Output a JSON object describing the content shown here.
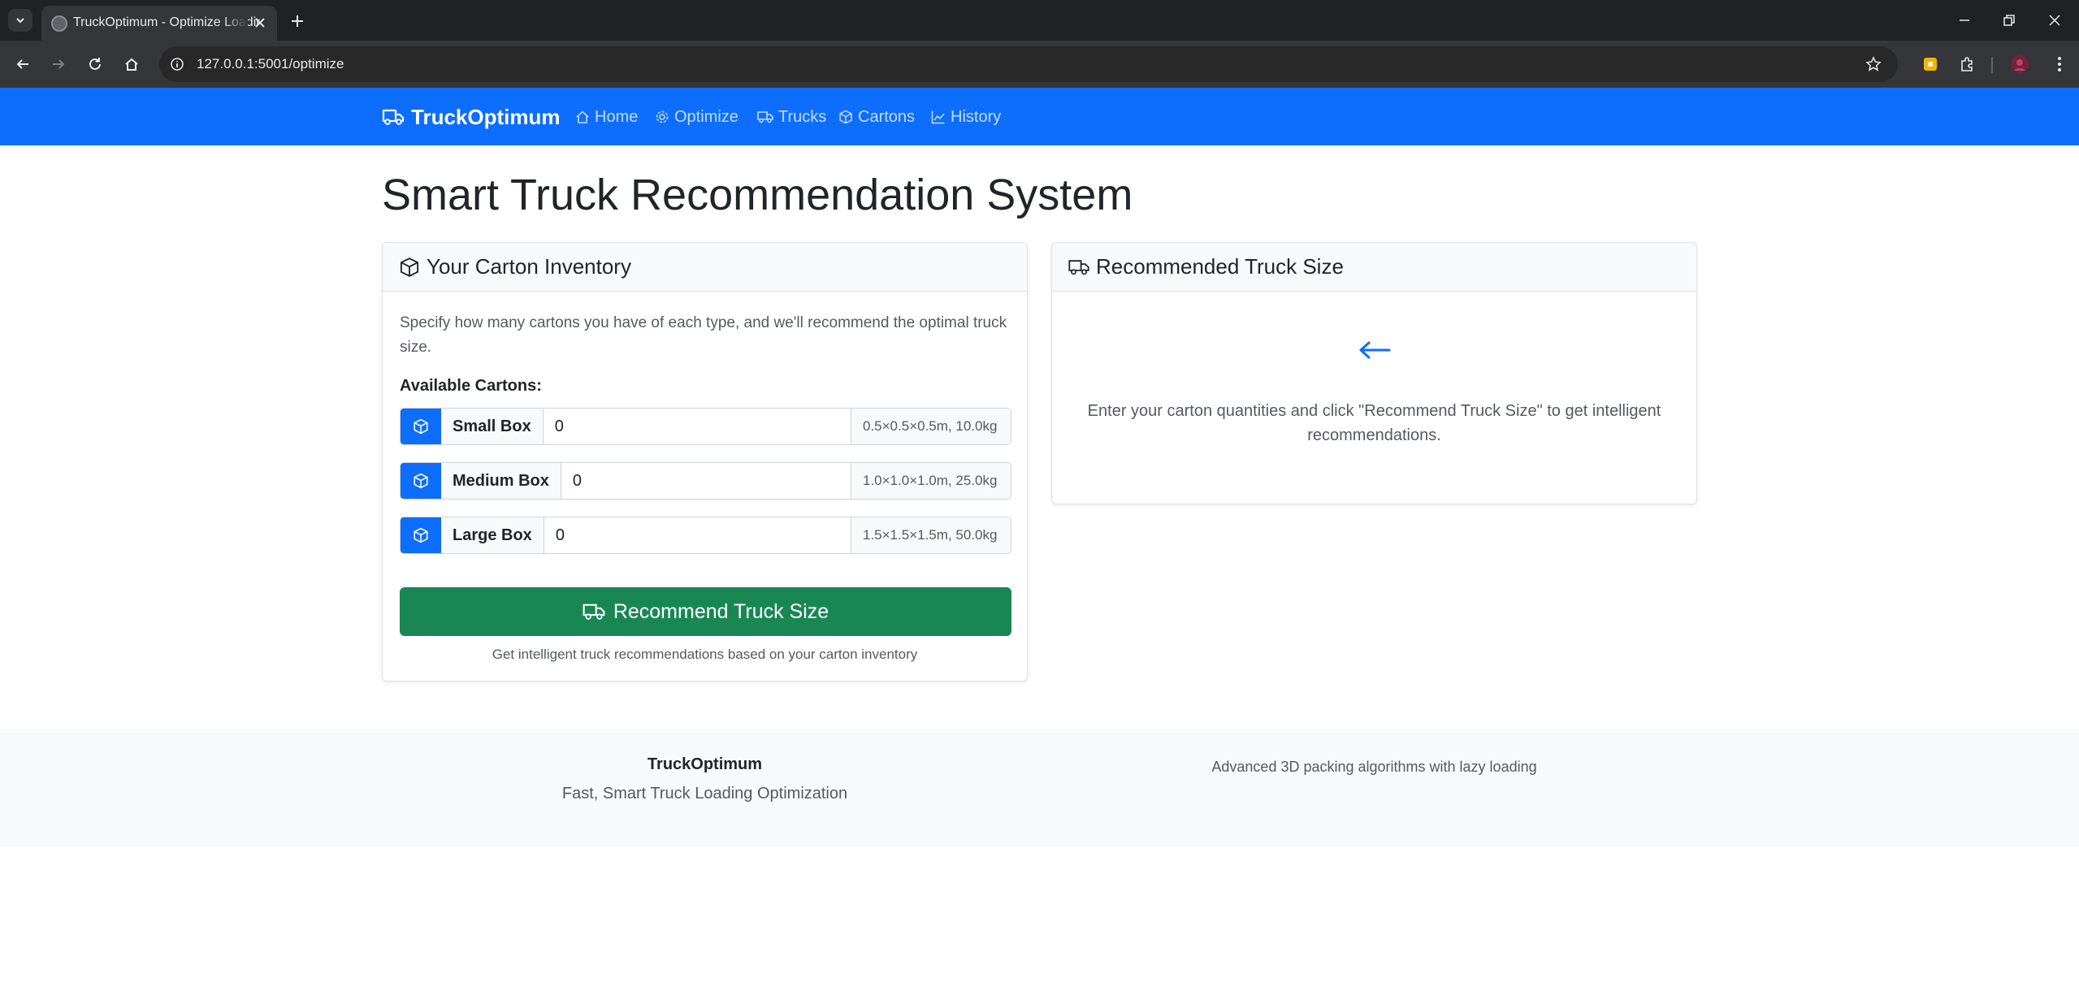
{
  "browser": {
    "tab_title": "TruckOptimum - Optimize Loading",
    "url": "127.0.0.1:5001/optimize"
  },
  "navbar": {
    "brand": "TruckOptimum",
    "links": [
      {
        "label": "Home",
        "icon": "house-icon"
      },
      {
        "label": "Optimize",
        "icon": "gear-icon"
      },
      {
        "label": "Trucks",
        "icon": "truck-icon"
      },
      {
        "label": "Cartons",
        "icon": "box-icon"
      },
      {
        "label": "History",
        "icon": "chart-line-icon"
      }
    ]
  },
  "page": {
    "title": "Smart Truck Recommendation System"
  },
  "inventory": {
    "header": "Your Carton Inventory",
    "description": "Specify how many cartons you have of each type, and we'll recommend the optimal truck size.",
    "available_label": "Available Cartons:",
    "cartons": [
      {
        "name": "Small Box",
        "value": "0",
        "spec": "0.5×0.5×0.5m, 10.0kg"
      },
      {
        "name": "Medium Box",
        "value": "0",
        "spec": "1.0×1.0×1.0m, 25.0kg"
      },
      {
        "name": "Large Box",
        "value": "0",
        "spec": "1.5×1.5×1.5m, 50.0kg"
      }
    ],
    "button_label": "Recommend Truck Size",
    "hint": "Get intelligent truck recommendations based on your carton inventory"
  },
  "result": {
    "header": "Recommended Truck Size",
    "placeholder": "Enter your carton quantities and click \"Recommend Truck Size\" to get intelligent recommendations."
  },
  "footer": {
    "brand": "TruckOptimum",
    "tagline": "Fast, Smart Truck Loading Optimization",
    "right_text": "Advanced 3D packing algorithms with lazy loading"
  },
  "colors": {
    "primary": "#0d6efd",
    "success": "#198754"
  }
}
